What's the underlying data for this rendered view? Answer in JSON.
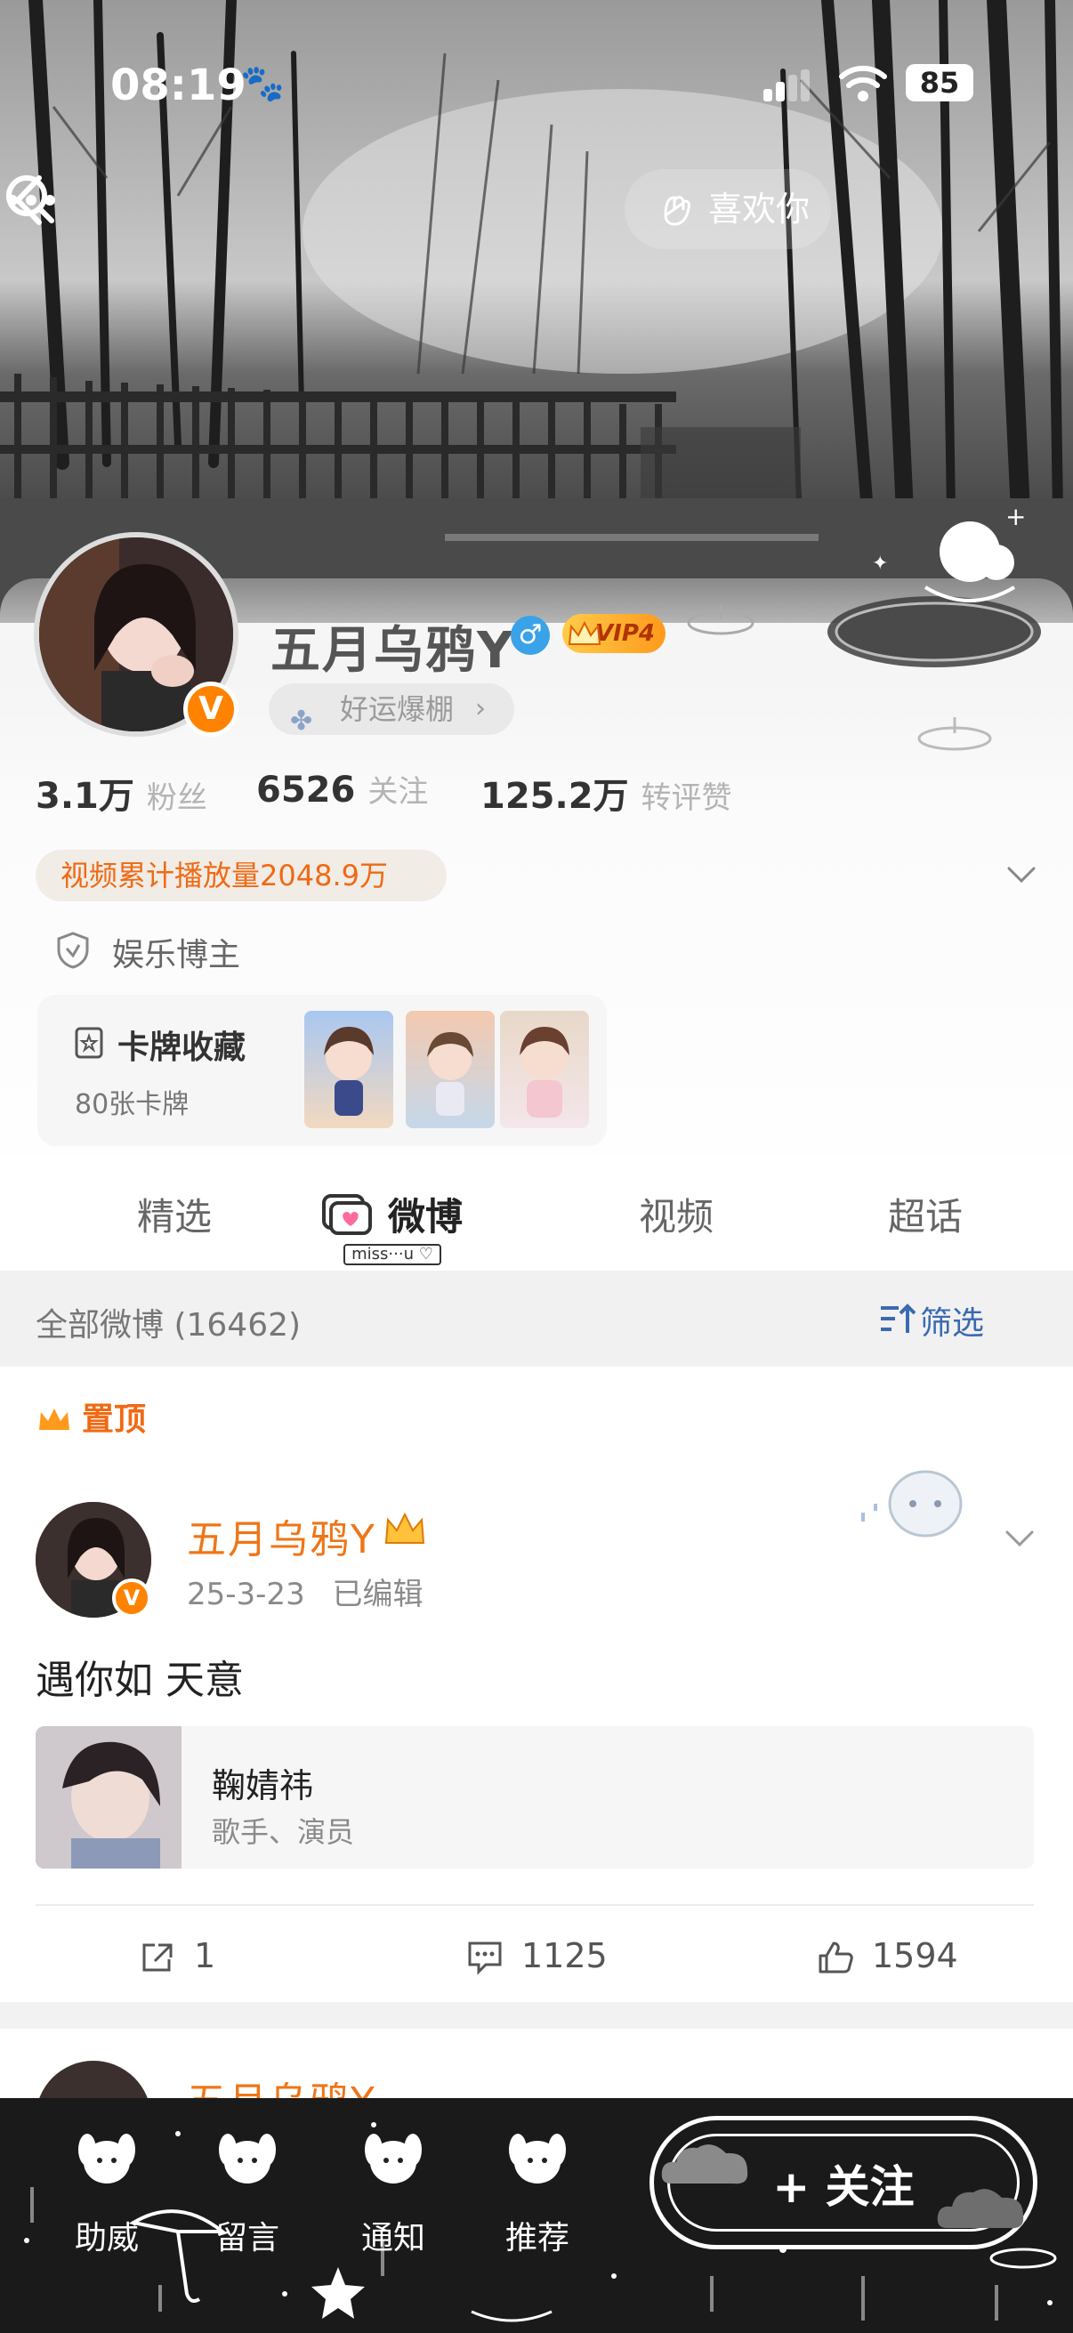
{
  "status_bar": {
    "time": "08:19",
    "paw_icon": "paw-icon",
    "battery": "85"
  },
  "header": {
    "like_label": "喜欢你"
  },
  "profile": {
    "name": "五月乌鸦Y",
    "gender_icon": "♂",
    "verified_badge": "V",
    "vip_label": "VIP4",
    "luck_tag": "好运爆棚",
    "stats": [
      {
        "value": "3.1万",
        "label": "粉丝"
      },
      {
        "value": "6526",
        "label": "关注"
      },
      {
        "value": "125.2万",
        "label": "转评赞"
      }
    ],
    "play_count": "视频累计播放量2048.9万",
    "category": "娱乐博主",
    "cards": {
      "title": "卡牌收藏",
      "count": "80张卡牌"
    }
  },
  "tabs": [
    {
      "label": "精选"
    },
    {
      "label": "微博"
    },
    {
      "label": "视频"
    },
    {
      "label": "超话"
    }
  ],
  "tab_tag": "miss···u ♡",
  "feed": {
    "count_label": "全部微博 (16462)",
    "filter_label": "筛选",
    "post": {
      "pinned_label": "置顶",
      "author": "五月乌鸦Y",
      "date": "25-3-23",
      "edited": "已编辑",
      "text": "遇你如 天意",
      "link_card": {
        "title": "鞠婧祎",
        "subtitle": "歌手、演员"
      },
      "actions": {
        "repost": "1",
        "comments": "1125",
        "likes": "1594"
      }
    },
    "post2": {
      "author": "五月乌鸦Y"
    }
  },
  "bottom_bar": {
    "items": [
      {
        "label": "助威"
      },
      {
        "label": "留言"
      },
      {
        "label": "通知"
      },
      {
        "label": "推荐"
      }
    ],
    "follow_label": "+ 关注"
  },
  "colors": {
    "accent": "#ef7517",
    "verified": "#ff8200",
    "link_blue": "#3a6ab0"
  }
}
